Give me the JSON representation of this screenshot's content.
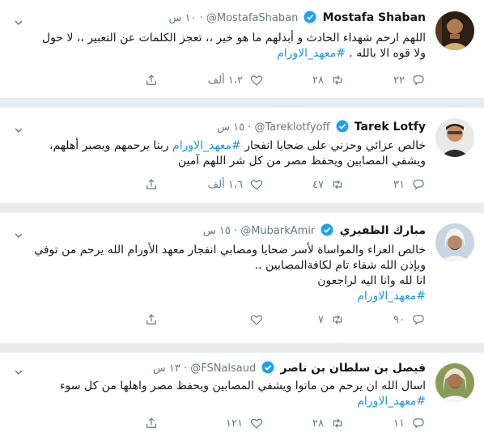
{
  "tweets": [
    {
      "name": "Mostafa Shaban",
      "handle": "@MostafaShaban",
      "time": "١٠ س",
      "lines": [
        "اللهم ارحم شهداء الحادث و أبدلهم ما هو خير ،، تعجز الكلمات عن التعبير ،، لا حول",
        "ولا قوه الا بالله . "
      ],
      "hashtag": "#معهد_الاورام",
      "replies": "٢٢",
      "retweets": "٢٨",
      "likes": "١،٢ ألف"
    },
    {
      "name": "Tarek Lotfy",
      "handle": "@Tareklotfyoff",
      "time": "١٥ س",
      "lines": [
        "خالص عزائي وحزني على ضحايا انفجار ",
        " ربنا يرحمهم ويصبر أهلهم،",
        "ويشفي المصابين ويحفظ مصر من كل شر اللهم آمين"
      ],
      "hashtag": "#معهد_الاورام",
      "replies": "٣١",
      "retweets": "٤٧",
      "likes": "١،٦ ألف"
    },
    {
      "name": "مبارك الظفيري",
      "handle": "@MubarkAmir",
      "time": "١٥ س",
      "lines": [
        "خالص العزاء والمواساة لأسر ضحايا ومصابي انفجار معهد الأورام الله يرحم من توفي",
        "وبإذن الله شفاء تام لكافةالمصابين ..",
        "انا لله وانا اليه لراجعون"
      ],
      "hashtag": "#معهد_الاورام",
      "replies": "٩٠",
      "retweets": "٧",
      "likes": ""
    },
    {
      "name": "فيصل بن سلطان بن ناصر",
      "handle": "@FSNalsaud",
      "time": "١٣ س",
      "lines": [
        "اسال الله ان يرحم من ماتوا ويشفي المصابين ويحفظ مصر واهلها من كل سوء"
      ],
      "hashtag": "#معهد_الاورام",
      "replies": "١١",
      "retweets": "٢٨",
      "likes": "١٢١"
    }
  ],
  "colors": {
    "accent": "#1b95e0",
    "verified": "#1da1f2",
    "muted": "#657786",
    "background": "#e6ecf0"
  },
  "icons": [
    "reply-icon",
    "retweet-icon",
    "like-icon",
    "share-icon",
    "verified-icon",
    "chevron-down-icon"
  ]
}
